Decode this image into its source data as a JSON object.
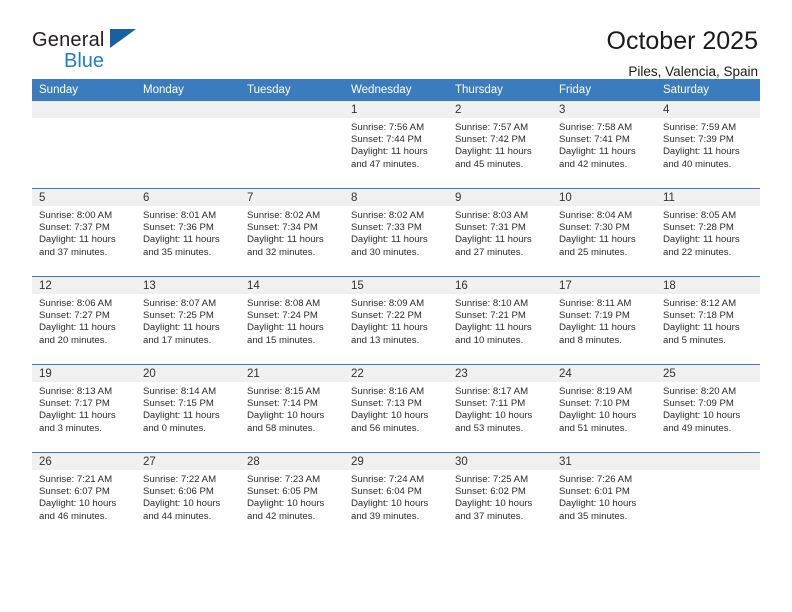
{
  "brand": {
    "line1": "General",
    "line2": "Blue",
    "triangle_color": "#17619e",
    "blue_color": "#1f7fc4"
  },
  "header": {
    "title": "October 2025",
    "subtitle": "Piles, Valencia, Spain"
  },
  "theme": {
    "header_blue": "#3a7cbe",
    "date_band_gray": "#f0f0f0",
    "text": "#2b2b2b"
  },
  "calendar": {
    "weekday_headers": [
      "Sunday",
      "Monday",
      "Tuesday",
      "Wednesday",
      "Thursday",
      "Friday",
      "Saturday"
    ],
    "weeks": [
      [
        {
          "day": "",
          "empty": true
        },
        {
          "day": "",
          "empty": true
        },
        {
          "day": "",
          "empty": true
        },
        {
          "day": "1",
          "sunrise": "Sunrise: 7:56 AM",
          "sunset": "Sunset: 7:44 PM",
          "daylight": "Daylight: 11 hours and 47 minutes."
        },
        {
          "day": "2",
          "sunrise": "Sunrise: 7:57 AM",
          "sunset": "Sunset: 7:42 PM",
          "daylight": "Daylight: 11 hours and 45 minutes."
        },
        {
          "day": "3",
          "sunrise": "Sunrise: 7:58 AM",
          "sunset": "Sunset: 7:41 PM",
          "daylight": "Daylight: 11 hours and 42 minutes."
        },
        {
          "day": "4",
          "sunrise": "Sunrise: 7:59 AM",
          "sunset": "Sunset: 7:39 PM",
          "daylight": "Daylight: 11 hours and 40 minutes."
        }
      ],
      [
        {
          "day": "5",
          "sunrise": "Sunrise: 8:00 AM",
          "sunset": "Sunset: 7:37 PM",
          "daylight": "Daylight: 11 hours and 37 minutes."
        },
        {
          "day": "6",
          "sunrise": "Sunrise: 8:01 AM",
          "sunset": "Sunset: 7:36 PM",
          "daylight": "Daylight: 11 hours and 35 minutes."
        },
        {
          "day": "7",
          "sunrise": "Sunrise: 8:02 AM",
          "sunset": "Sunset: 7:34 PM",
          "daylight": "Daylight: 11 hours and 32 minutes."
        },
        {
          "day": "8",
          "sunrise": "Sunrise: 8:02 AM",
          "sunset": "Sunset: 7:33 PM",
          "daylight": "Daylight: 11 hours and 30 minutes."
        },
        {
          "day": "9",
          "sunrise": "Sunrise: 8:03 AM",
          "sunset": "Sunset: 7:31 PM",
          "daylight": "Daylight: 11 hours and 27 minutes."
        },
        {
          "day": "10",
          "sunrise": "Sunrise: 8:04 AM",
          "sunset": "Sunset: 7:30 PM",
          "daylight": "Daylight: 11 hours and 25 minutes."
        },
        {
          "day": "11",
          "sunrise": "Sunrise: 8:05 AM",
          "sunset": "Sunset: 7:28 PM",
          "daylight": "Daylight: 11 hours and 22 minutes."
        }
      ],
      [
        {
          "day": "12",
          "sunrise": "Sunrise: 8:06 AM",
          "sunset": "Sunset: 7:27 PM",
          "daylight": "Daylight: 11 hours and 20 minutes."
        },
        {
          "day": "13",
          "sunrise": "Sunrise: 8:07 AM",
          "sunset": "Sunset: 7:25 PM",
          "daylight": "Daylight: 11 hours and 17 minutes."
        },
        {
          "day": "14",
          "sunrise": "Sunrise: 8:08 AM",
          "sunset": "Sunset: 7:24 PM",
          "daylight": "Daylight: 11 hours and 15 minutes."
        },
        {
          "day": "15",
          "sunrise": "Sunrise: 8:09 AM",
          "sunset": "Sunset: 7:22 PM",
          "daylight": "Daylight: 11 hours and 13 minutes."
        },
        {
          "day": "16",
          "sunrise": "Sunrise: 8:10 AM",
          "sunset": "Sunset: 7:21 PM",
          "daylight": "Daylight: 11 hours and 10 minutes."
        },
        {
          "day": "17",
          "sunrise": "Sunrise: 8:11 AM",
          "sunset": "Sunset: 7:19 PM",
          "daylight": "Daylight: 11 hours and 8 minutes."
        },
        {
          "day": "18",
          "sunrise": "Sunrise: 8:12 AM",
          "sunset": "Sunset: 7:18 PM",
          "daylight": "Daylight: 11 hours and 5 minutes."
        }
      ],
      [
        {
          "day": "19",
          "sunrise": "Sunrise: 8:13 AM",
          "sunset": "Sunset: 7:17 PM",
          "daylight": "Daylight: 11 hours and 3 minutes."
        },
        {
          "day": "20",
          "sunrise": "Sunrise: 8:14 AM",
          "sunset": "Sunset: 7:15 PM",
          "daylight": "Daylight: 11 hours and 0 minutes."
        },
        {
          "day": "21",
          "sunrise": "Sunrise: 8:15 AM",
          "sunset": "Sunset: 7:14 PM",
          "daylight": "Daylight: 10 hours and 58 minutes."
        },
        {
          "day": "22",
          "sunrise": "Sunrise: 8:16 AM",
          "sunset": "Sunset: 7:13 PM",
          "daylight": "Daylight: 10 hours and 56 minutes."
        },
        {
          "day": "23",
          "sunrise": "Sunrise: 8:17 AM",
          "sunset": "Sunset: 7:11 PM",
          "daylight": "Daylight: 10 hours and 53 minutes."
        },
        {
          "day": "24",
          "sunrise": "Sunrise: 8:19 AM",
          "sunset": "Sunset: 7:10 PM",
          "daylight": "Daylight: 10 hours and 51 minutes."
        },
        {
          "day": "25",
          "sunrise": "Sunrise: 8:20 AM",
          "sunset": "Sunset: 7:09 PM",
          "daylight": "Daylight: 10 hours and 49 minutes."
        }
      ],
      [
        {
          "day": "26",
          "sunrise": "Sunrise: 7:21 AM",
          "sunset": "Sunset: 6:07 PM",
          "daylight": "Daylight: 10 hours and 46 minutes."
        },
        {
          "day": "27",
          "sunrise": "Sunrise: 7:22 AM",
          "sunset": "Sunset: 6:06 PM",
          "daylight": "Daylight: 10 hours and 44 minutes."
        },
        {
          "day": "28",
          "sunrise": "Sunrise: 7:23 AM",
          "sunset": "Sunset: 6:05 PM",
          "daylight": "Daylight: 10 hours and 42 minutes."
        },
        {
          "day": "29",
          "sunrise": "Sunrise: 7:24 AM",
          "sunset": "Sunset: 6:04 PM",
          "daylight": "Daylight: 10 hours and 39 minutes."
        },
        {
          "day": "30",
          "sunrise": "Sunrise: 7:25 AM",
          "sunset": "Sunset: 6:02 PM",
          "daylight": "Daylight: 10 hours and 37 minutes."
        },
        {
          "day": "31",
          "sunrise": "Sunrise: 7:26 AM",
          "sunset": "Sunset: 6:01 PM",
          "daylight": "Daylight: 10 hours and 35 minutes."
        },
        {
          "day": "",
          "empty": true
        }
      ]
    ]
  }
}
